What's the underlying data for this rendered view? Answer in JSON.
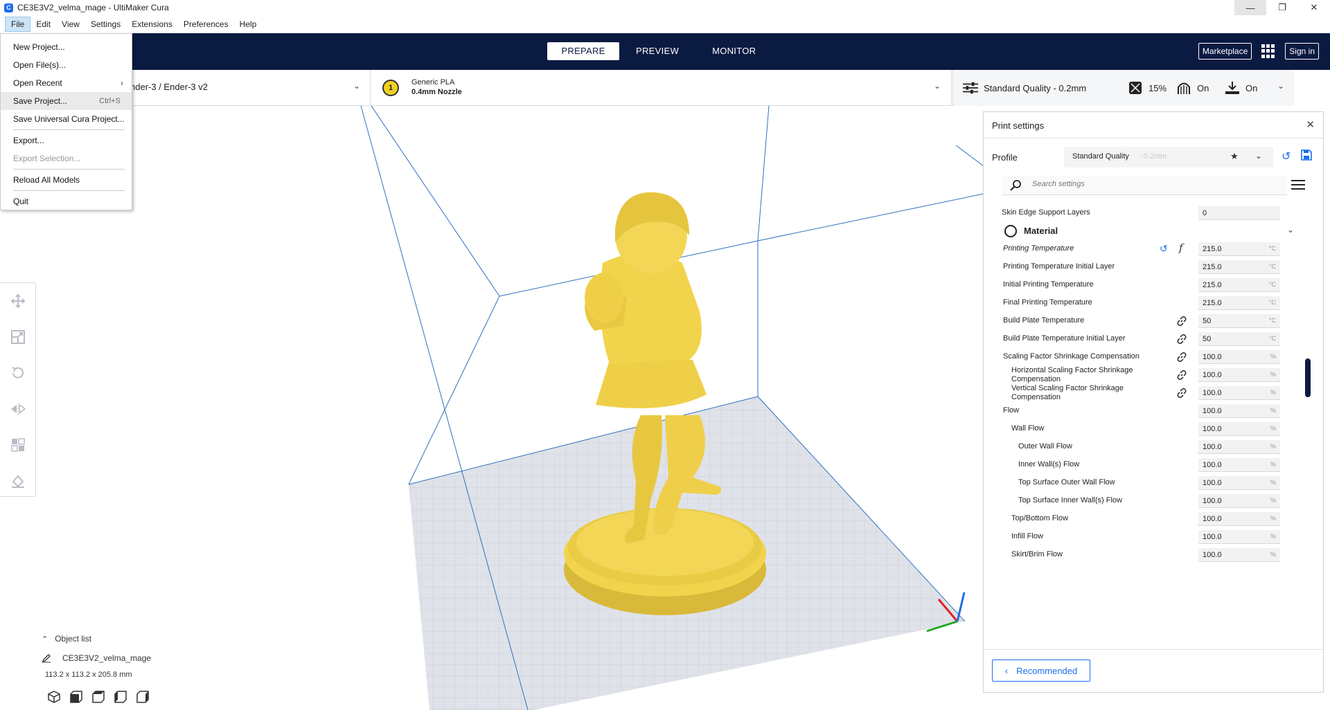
{
  "window": {
    "title": "CE3E3V2_velma_mage - UltiMaker Cura",
    "controls": [
      "—",
      "❐",
      "✕"
    ]
  },
  "menubar": {
    "items": [
      "File",
      "Edit",
      "View",
      "Settings",
      "Extensions",
      "Preferences",
      "Help"
    ]
  },
  "file_menu": {
    "items": [
      {
        "label": "New Project...",
        "shortcut": "",
        "disabled": false
      },
      {
        "label": "Open File(s)...",
        "shortcut": "",
        "disabled": false
      },
      {
        "label": "Open Recent",
        "shortcut": "",
        "submenu": true
      },
      {
        "label": "Save Project...",
        "shortcut": "Ctrl+S",
        "hover": true
      },
      {
        "label": "Save Universal Cura Project...",
        "shortcut": ""
      },
      {
        "label": "Export...",
        "shortcut": ""
      },
      {
        "label": "Export Selection...",
        "shortcut": "",
        "disabled": true
      },
      {
        "label": "Reload All Models",
        "shortcut": ""
      },
      {
        "label": "Quit",
        "shortcut": ""
      }
    ]
  },
  "header": {
    "tabs": [
      "PREPARE",
      "PREVIEW",
      "MONITOR"
    ],
    "active_tab": "PREPARE",
    "marketplace_label": "Marketplace",
    "signin_label": "Sign in"
  },
  "printer": {
    "name": "nder-3 / Ender-3 v2"
  },
  "material": {
    "extruder": "1",
    "name": "Generic PLA",
    "nozzle": "0.4mm Nozzle"
  },
  "quality_bar": {
    "profile": "Standard Quality - 0.2mm",
    "infill": "15%",
    "support": "On",
    "adhesion": "On"
  },
  "print_settings": {
    "title": "Print settings",
    "profile_label": "Profile",
    "profile_name": "Standard Quality",
    "profile_suffix": "- 0.2mm",
    "search_placeholder": "Search settings",
    "recommended_label": "Recommended",
    "rows": [
      {
        "label": "Skin Edge Support Layers",
        "value": "0",
        "unit": "",
        "indent": 0
      },
      {
        "category": "Material"
      },
      {
        "label": "Printing Temperature",
        "value": "215.0",
        "unit": "°C",
        "indent": 1,
        "italic": true,
        "reset": true,
        "fx": true
      },
      {
        "label": "Printing Temperature Initial Layer",
        "value": "215.0",
        "unit": "°C",
        "indent": 1
      },
      {
        "label": "Initial Printing Temperature",
        "value": "215.0",
        "unit": "°C",
        "indent": 1
      },
      {
        "label": "Final Printing Temperature",
        "value": "215.0",
        "unit": "°C",
        "indent": 1
      },
      {
        "label": "Build Plate Temperature",
        "value": "50",
        "unit": "°C",
        "indent": 1,
        "link": true
      },
      {
        "label": "Build Plate Temperature Initial Layer",
        "value": "50",
        "unit": "°C",
        "indent": 1,
        "link": true
      },
      {
        "label": "Scaling Factor Shrinkage Compensation",
        "value": "100.0",
        "unit": "%",
        "indent": 1,
        "link": true
      },
      {
        "label": "Horizontal Scaling Factor Shrinkage Compensation",
        "value": "100.0",
        "unit": "%",
        "indent": 2,
        "link": true,
        "two_line": true
      },
      {
        "label": "Vertical Scaling Factor Shrinkage Compensation",
        "value": "100.0",
        "unit": "%",
        "indent": 2,
        "link": true,
        "two_line": true
      },
      {
        "label": "Flow",
        "value": "100.0",
        "unit": "%",
        "indent": 1
      },
      {
        "label": "Wall Flow",
        "value": "100.0",
        "unit": "%",
        "indent": 2
      },
      {
        "label": "Outer Wall Flow",
        "value": "100.0",
        "unit": "%",
        "indent": 3
      },
      {
        "label": "Inner Wall(s) Flow",
        "value": "100.0",
        "unit": "%",
        "indent": 3
      },
      {
        "label": "Top Surface Outer Wall Flow",
        "value": "100.0",
        "unit": "%",
        "indent": 3
      },
      {
        "label": "Top Surface Inner Wall(s) Flow",
        "value": "100.0",
        "unit": "%",
        "indent": 3
      },
      {
        "label": "Top/Bottom Flow",
        "value": "100.0",
        "unit": "%",
        "indent": 2
      },
      {
        "label": "Infill Flow",
        "value": "100.0",
        "unit": "%",
        "indent": 2
      },
      {
        "label": "Skirt/Brim Flow",
        "value": "100.0",
        "unit": "%",
        "indent": 2
      }
    ]
  },
  "object_list": {
    "header": "Object list",
    "object_name": "CE3E3V2_velma_mage",
    "dimensions": "113.2 x 113.2 x 205.8 mm"
  },
  "tools": [
    "move-icon",
    "scale-icon",
    "rotate-icon",
    "mirror-icon",
    "per-model-settings-icon",
    "support-blocker-icon"
  ],
  "colors": {
    "header_bg": "#0b1a41",
    "accent": "#196ef0",
    "model": "#f2d34c",
    "build_volume_edge": "#2f6fbf"
  }
}
